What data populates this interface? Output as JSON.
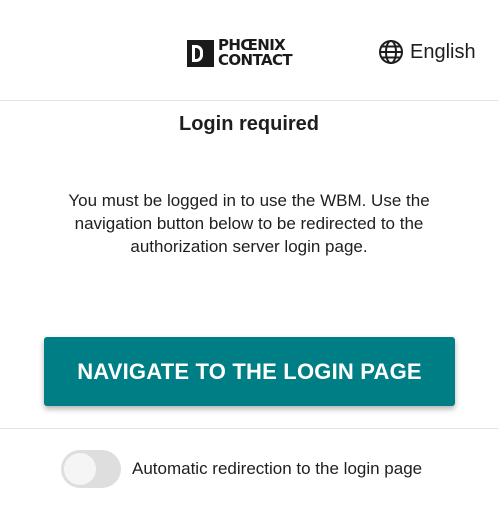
{
  "header": {
    "logo_line1": "PHŒNIX",
    "logo_line2": "CONTACT",
    "language_icon": "globe-icon",
    "language_label": "English"
  },
  "main": {
    "title": "Login required",
    "message": "You must be logged in to use the WBM. Use the navigation button below to be redirected to the authorization server login page.",
    "navigate_button_label": "NAVIGATE TO THE LOGIN PAGE"
  },
  "footer": {
    "auto_redirect_label": "Automatic redirection to the login page",
    "auto_redirect_enabled": false
  },
  "colors": {
    "accent": "#007e85",
    "toggle_off": "#dedede",
    "divider": "#e3e3e3"
  }
}
